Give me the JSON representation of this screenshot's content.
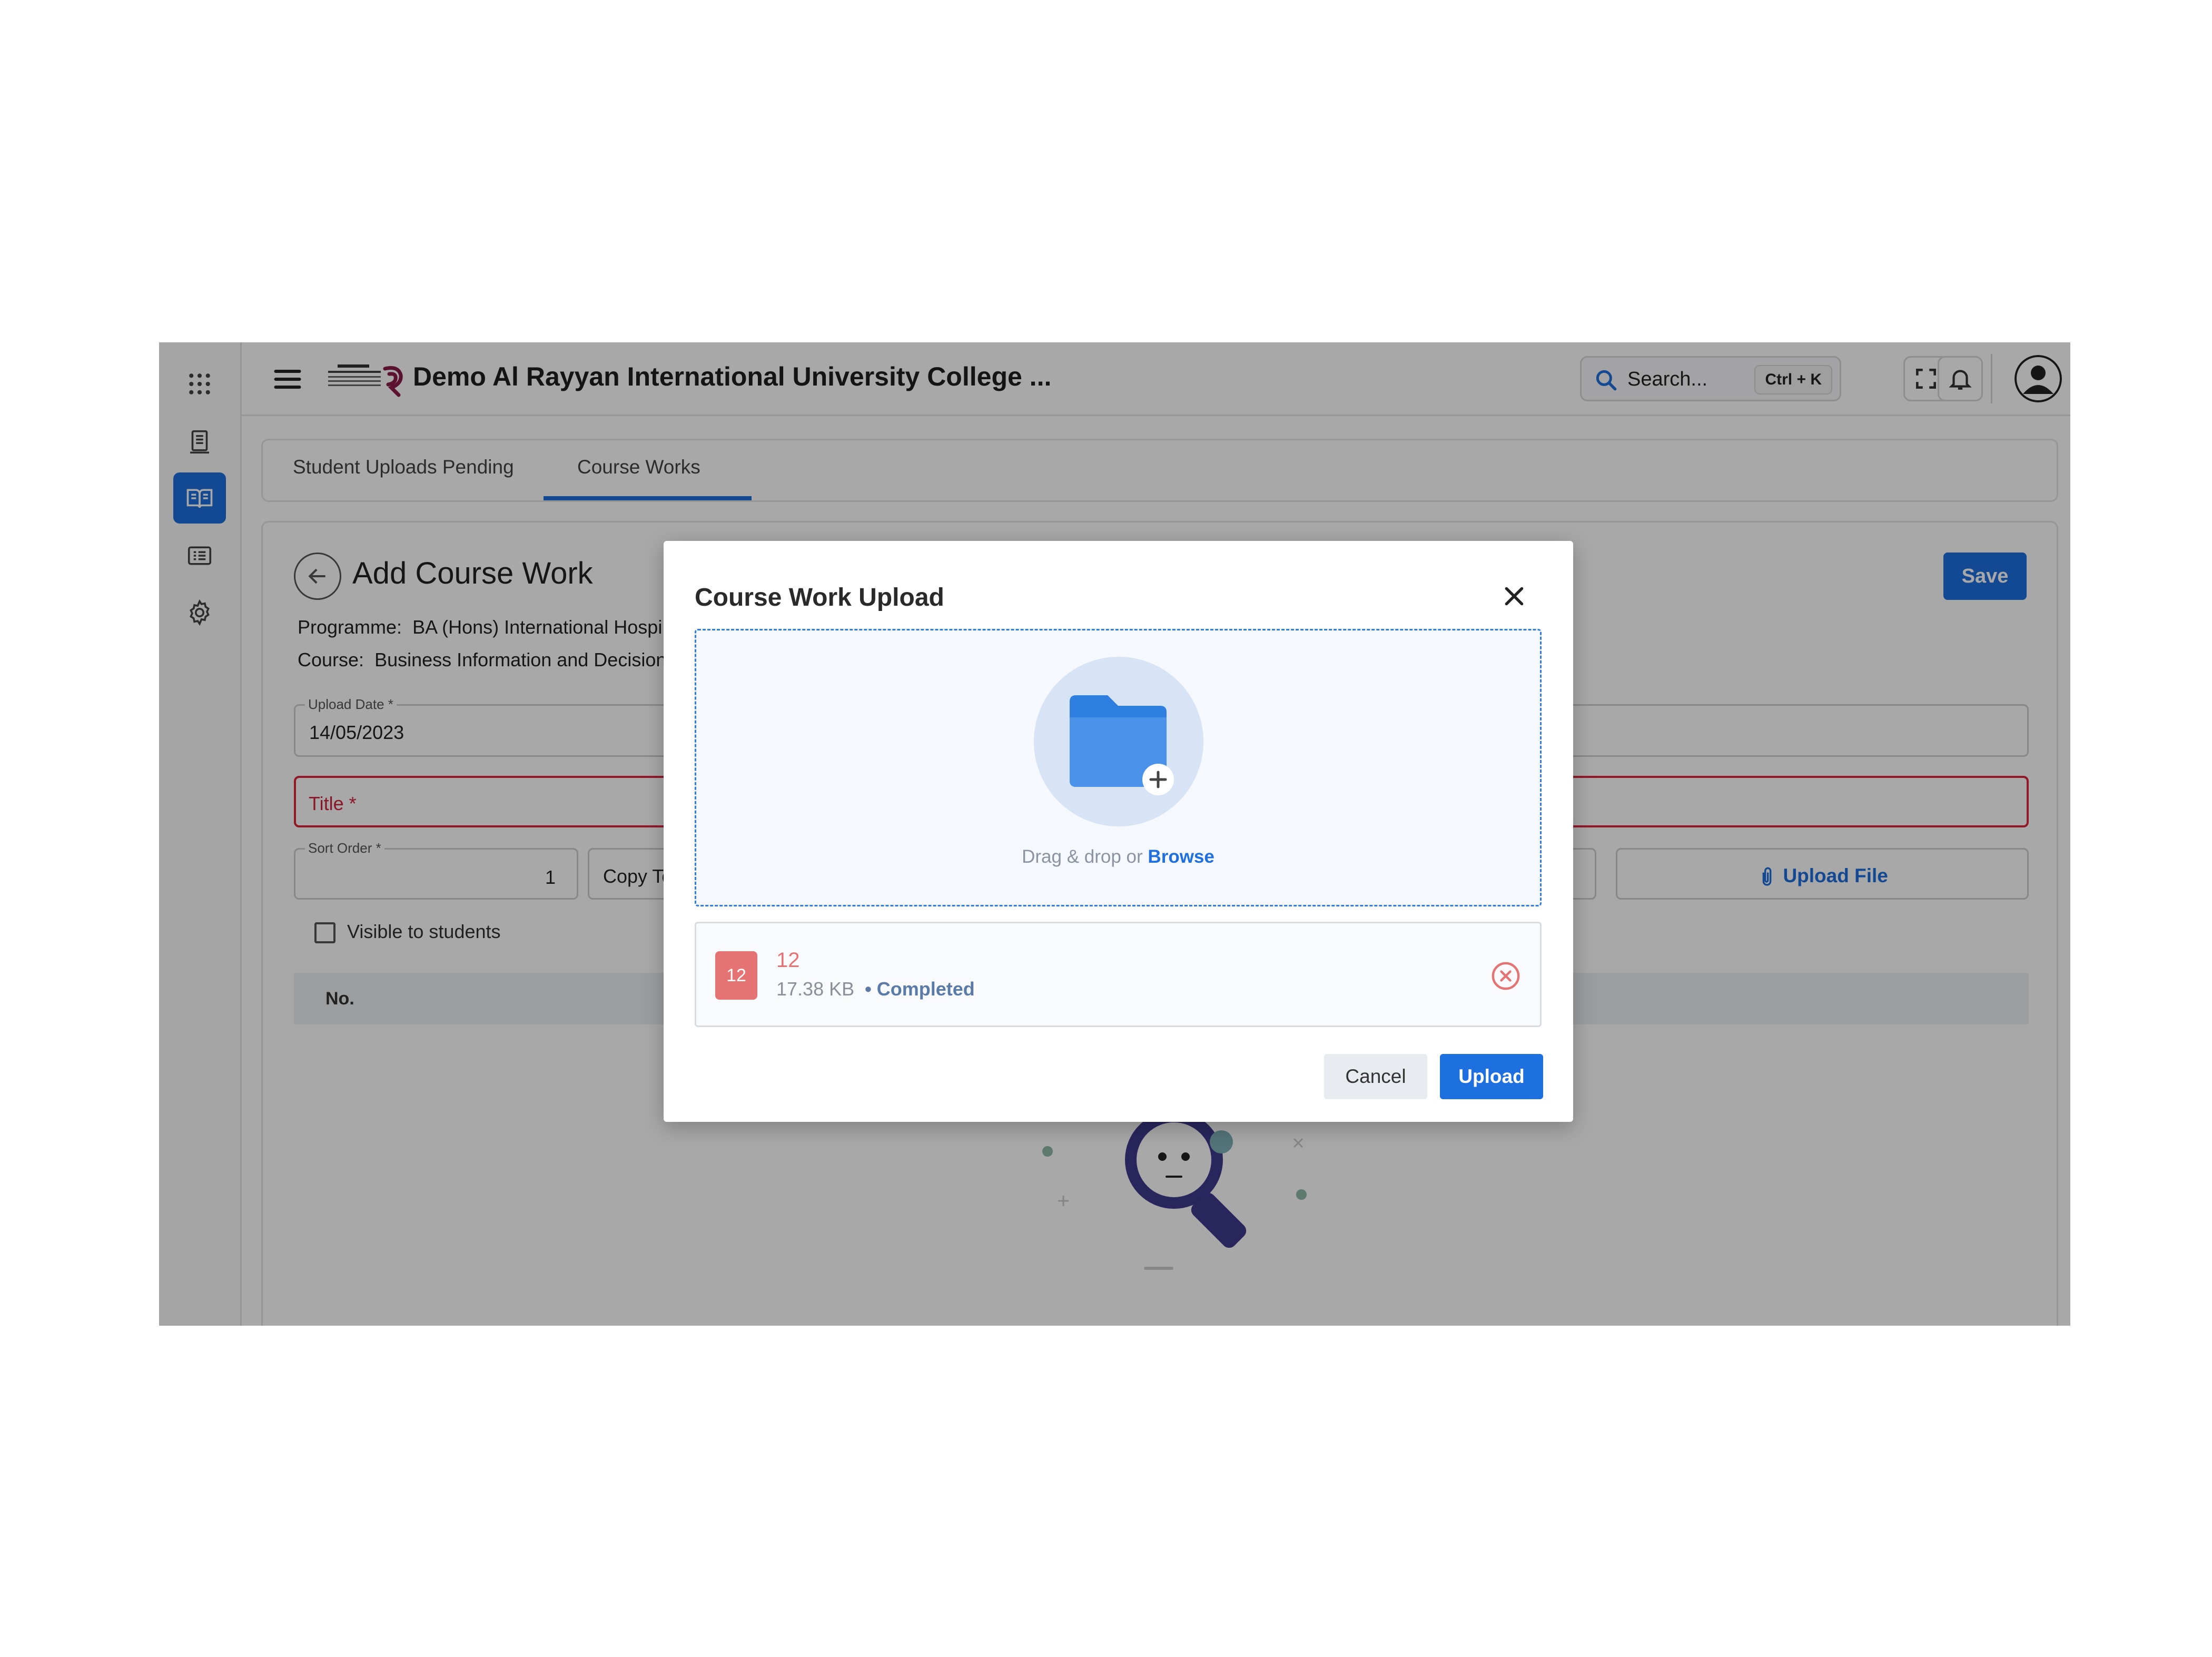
{
  "header": {
    "app_title": "Demo Al Rayyan International University College ...",
    "logo_text": "AL RAYYAN INTERNATIONAL UNIVERSITY COLLEGE",
    "search_placeholder": "Search...",
    "search_shortcut": "Ctrl + K"
  },
  "sidebar": {
    "items": [
      {
        "name": "apps",
        "icon": "grid-icon"
      },
      {
        "name": "document",
        "icon": "document-icon"
      },
      {
        "name": "course-works",
        "icon": "book-icon",
        "active": true
      },
      {
        "name": "list",
        "icon": "list-icon"
      },
      {
        "name": "settings",
        "icon": "gear-icon"
      }
    ]
  },
  "tabs": [
    {
      "label": "Student Uploads Pending",
      "active": false
    },
    {
      "label": "Course Works",
      "active": true
    }
  ],
  "page": {
    "title": "Add Course Work",
    "save_label": "Save",
    "programme_label": "Programme:",
    "programme_value": "BA (Hons) International Hospi",
    "course_label": "Course:",
    "course_value": "Business Information and Decision",
    "upload_date_label": "Upload Date *",
    "upload_date_value": "14/05/2023",
    "title_placeholder": "Title *",
    "sort_order_label": "Sort Order *",
    "sort_order_value": "1",
    "copy_to_value": "Copy To",
    "upload_file_label": "Upload File",
    "visible_label": "Visible to students",
    "visible_checked": false,
    "table_header_no": "No."
  },
  "modal": {
    "title": "Course Work Upload",
    "drop_text": "Drag & drop or",
    "browse_label": "Browse",
    "file": {
      "badge": "12",
      "name": "12",
      "size": "17.38 KB",
      "status": "• Completed"
    },
    "cancel_label": "Cancel",
    "upload_label": "Upload"
  },
  "colors": {
    "accent": "#1e6fe0",
    "error": "#d2233a",
    "file_badge": "#e57373",
    "overlay": "rgba(0,0,0,0.34)"
  }
}
